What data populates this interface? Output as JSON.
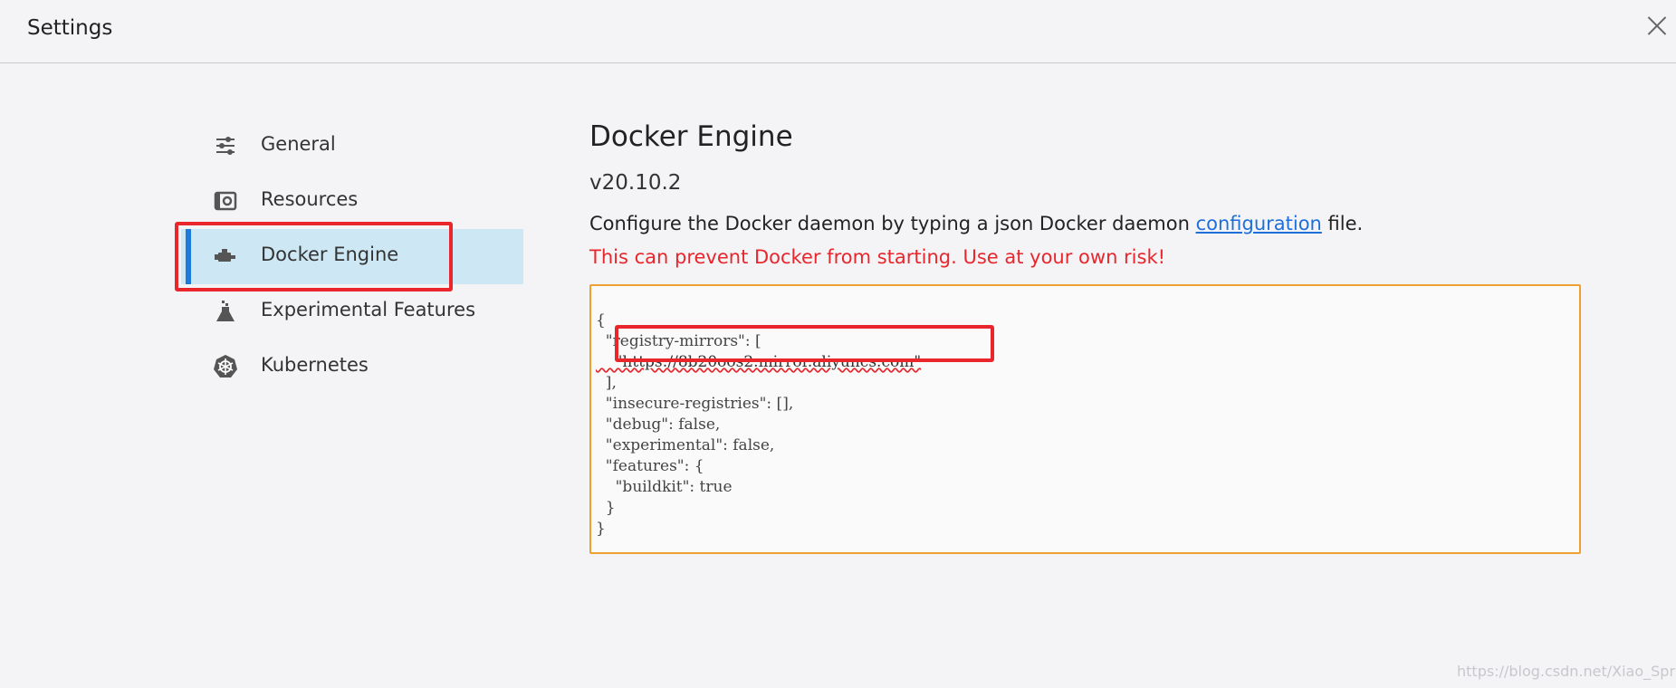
{
  "window": {
    "title": "Settings",
    "close_icon": "close-icon"
  },
  "sidebar": {
    "items": [
      {
        "label": "General",
        "icon": "sliders-icon",
        "active": false
      },
      {
        "label": "Resources",
        "icon": "resources-icon",
        "active": false
      },
      {
        "label": "Docker Engine",
        "icon": "docker-engine-icon",
        "active": true
      },
      {
        "label": "Experimental Features",
        "icon": "flask-icon",
        "active": false
      },
      {
        "label": "Kubernetes",
        "icon": "kubernetes-icon",
        "active": false
      }
    ]
  },
  "main": {
    "title": "Docker Engine",
    "version": "v20.10.2",
    "description_prefix": "Configure the Docker daemon by typing a json Docker daemon ",
    "description_link": "configuration",
    "description_suffix": " file.",
    "warning": "This can prevent Docker from starting. Use at your own risk!",
    "editor": {
      "lines": [
        "{",
        "  \"registry-mirrors\": [",
        "    \"https://8b20oos2.mirror.aliyuncs.com\"",
        "  ],",
        "  \"insecure-registries\": [],",
        "  \"debug\": false,",
        "  \"experimental\": false,",
        "  \"features\": {",
        "    \"buildkit\": true",
        "  }",
        "}"
      ]
    }
  },
  "watermark": "https://blog.csdn.net/Xiao_Spring",
  "colors": {
    "accent_blue": "#1e7ad9",
    "active_bg": "#cde8f4",
    "warning_red": "#e8262c",
    "editor_border": "#f0a030"
  }
}
